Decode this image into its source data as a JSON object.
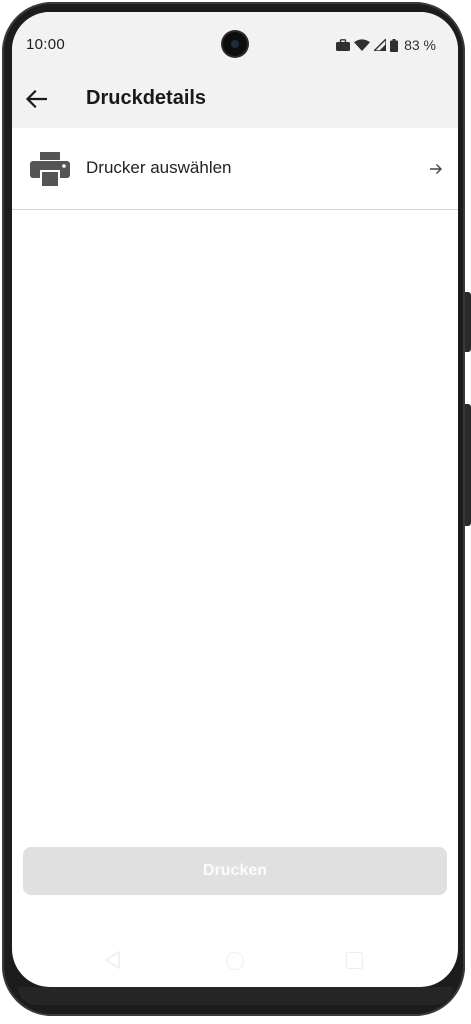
{
  "status_bar": {
    "time": "10:00",
    "battery_percent": "83 %",
    "icons": [
      "briefcase-icon",
      "wifi-icon",
      "signal-icon",
      "battery-icon"
    ]
  },
  "app_bar": {
    "back_icon": "arrow-left-icon",
    "title": "Druckdetails"
  },
  "printer_select": {
    "icon": "printer-icon",
    "label": "Drucker auswählen",
    "trailing_icon": "arrow-right-icon"
  },
  "actions": {
    "print_label": "Drucken"
  },
  "navigation_bar": {
    "icons": [
      "nav-back-icon",
      "nav-home-icon",
      "nav-recents-icon"
    ]
  },
  "colors": {
    "app_bar_bg": "#f2f2f2",
    "button_disabled_bg": "#e0e0e0",
    "button_disabled_text": "#fbfbfb",
    "icon_gray": "#555555",
    "divider": "#d4d4d4"
  }
}
